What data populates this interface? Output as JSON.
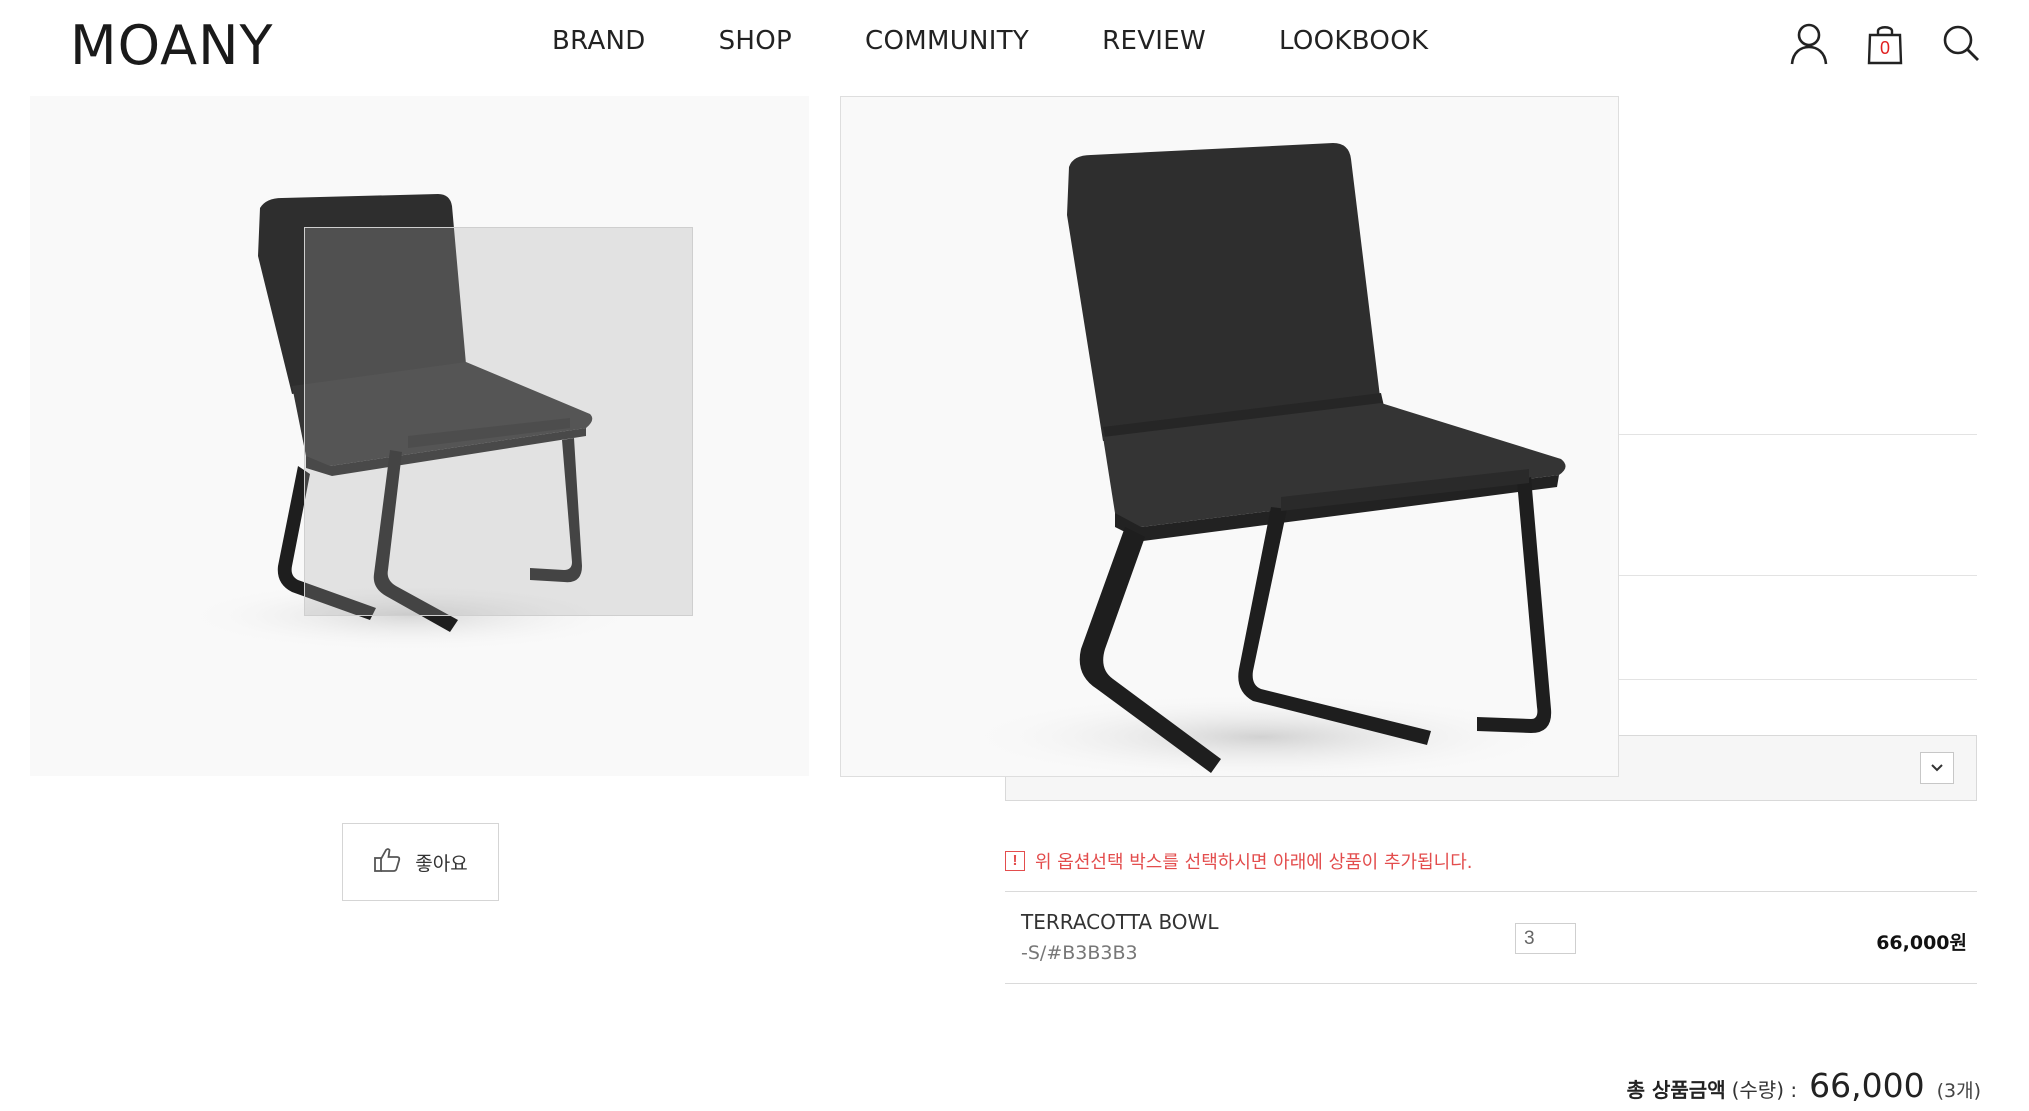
{
  "brand": {
    "logo": "MOANY"
  },
  "nav": {
    "items": [
      {
        "label": "BRAND"
      },
      {
        "label": "SHOP"
      },
      {
        "label": "COMMUNITY"
      },
      {
        "label": "REVIEW"
      },
      {
        "label": "LOOKBOOK"
      }
    ]
  },
  "header_icons": {
    "account": "user-icon",
    "cart": "shopping-bag-icon",
    "cart_count": "0",
    "search": "search-icon"
  },
  "like": {
    "label": "좋아요",
    "icon": "thumbs-up-icon"
  },
  "notice": {
    "icon": "!",
    "text": "위 옵션선택 박스를 선택하시면 아래에 상품이 추가됩니다."
  },
  "selected_item": {
    "name": "TERRACOTTA BOWL",
    "option": "-S/#B3B3B3",
    "quantity": "3",
    "price": "66,000원"
  },
  "total": {
    "label": "총 상품금액",
    "sub": "(수량) :",
    "value": "66,000",
    "count": "(3개)"
  },
  "colors": {
    "accent_red": "#e34d4d",
    "chair": "#2b2b2b",
    "image_bg": "#f9f9f9"
  }
}
